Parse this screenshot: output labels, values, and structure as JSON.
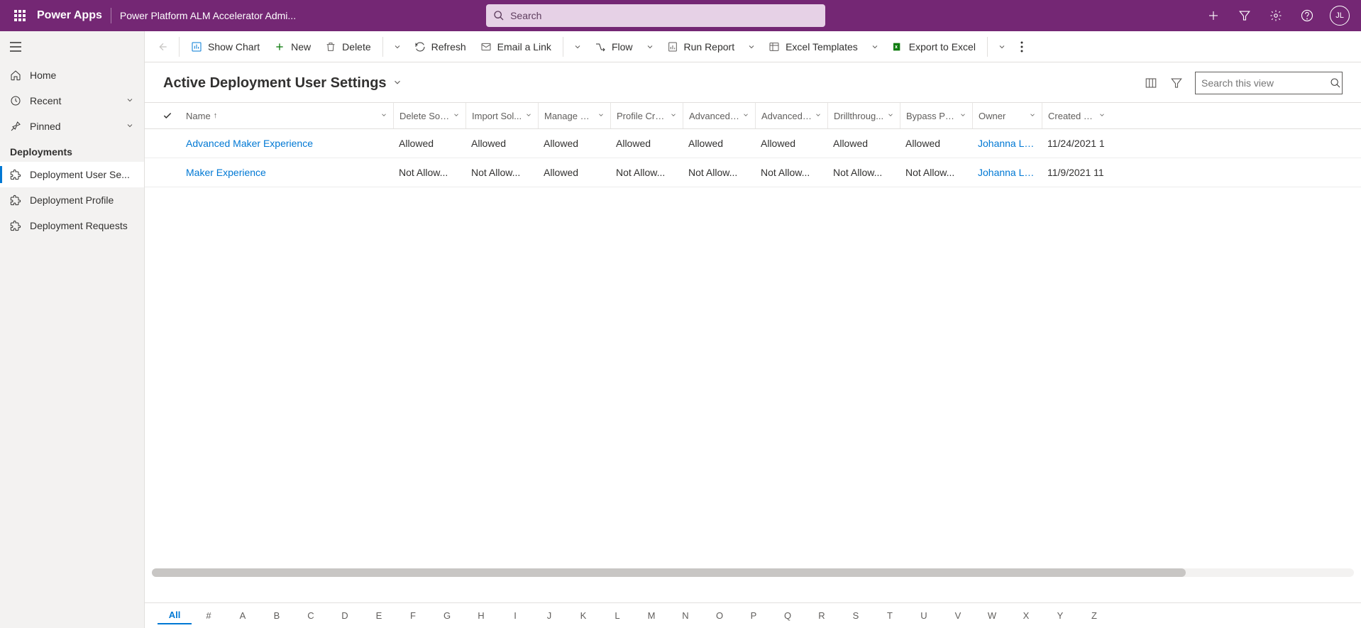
{
  "header": {
    "app_name": "Power Apps",
    "context": "Power Platform ALM Accelerator Admi...",
    "search_placeholder": "Search",
    "avatar_initials": "JL"
  },
  "sidebar": {
    "home": "Home",
    "recent": "Recent",
    "pinned": "Pinned",
    "group_label": "Deployments",
    "items": [
      {
        "label": "Deployment User Se..."
      },
      {
        "label": "Deployment Profile"
      },
      {
        "label": "Deployment Requests"
      }
    ]
  },
  "commands": {
    "show_chart": "Show Chart",
    "new": "New",
    "delete": "Delete",
    "refresh": "Refresh",
    "email_link": "Email a Link",
    "flow": "Flow",
    "run_report": "Run Report",
    "excel_templates": "Excel Templates",
    "export_excel": "Export to Excel"
  },
  "view": {
    "title": "Active Deployment User Settings",
    "search_placeholder": "Search this view"
  },
  "columns": {
    "name": "Name",
    "delete_solu": "Delete Solu...",
    "import_sol": "Import Sol...",
    "manage_so": "Manage So...",
    "profile_crea": "Profile Crea...",
    "advanced1": "Advanced ...",
    "advanced2": "Advanced ...",
    "drillthroug": "Drillthroug...",
    "bypass_pre": "Bypass Pre...",
    "owner": "Owner",
    "created_on": "Created On"
  },
  "grid": {
    "rows": [
      {
        "name": "Advanced Maker Experience",
        "c1": "Allowed",
        "c2": "Allowed",
        "c3": "Allowed",
        "c4": "Allowed",
        "c5": "Allowed",
        "c6": "Allowed",
        "c7": "Allowed",
        "c8": "Allowed",
        "owner": "Johanna Loren",
        "created": "11/24/2021 1"
      },
      {
        "name": "Maker Experience",
        "c1": "Not Allow...",
        "c2": "Not Allow...",
        "c3": "Allowed",
        "c4": "Not Allow...",
        "c5": "Not Allow...",
        "c6": "Not Allow...",
        "c7": "Not Allow...",
        "c8": "Not Allow...",
        "owner": "Johanna Loren",
        "created": "11/9/2021 11"
      }
    ]
  },
  "alpha": {
    "items": [
      "All",
      "#",
      "A",
      "B",
      "C",
      "D",
      "E",
      "F",
      "G",
      "H",
      "I",
      "J",
      "K",
      "L",
      "M",
      "N",
      "O",
      "P",
      "Q",
      "R",
      "S",
      "T",
      "U",
      "V",
      "W",
      "X",
      "Y",
      "Z"
    ]
  }
}
